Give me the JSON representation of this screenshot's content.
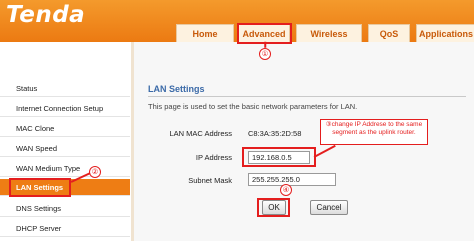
{
  "brand": {
    "logo": "Tenda"
  },
  "tabs": [
    {
      "label": "Home"
    },
    {
      "label": "Advanced"
    },
    {
      "label": "Wireless"
    },
    {
      "label": "QoS"
    },
    {
      "label": "Applications"
    }
  ],
  "sidebar": {
    "items": [
      {
        "label": "Status"
      },
      {
        "label": "Internet Connection Setup"
      },
      {
        "label": "MAC Clone"
      },
      {
        "label": "WAN Speed"
      },
      {
        "label": "WAN Medium Type"
      },
      {
        "label": "LAN Settings"
      },
      {
        "label": "DNS Settings"
      },
      {
        "label": "DHCP Server"
      }
    ]
  },
  "main": {
    "section_title": "LAN Settings",
    "description": "This page is used to set the basic network parameters for LAN.",
    "mac_label": "LAN MAC Address",
    "mac_value": "C8:3A:35:2D:58",
    "ip_label": "IP Address",
    "ip_value": "192.168.0.5",
    "subnet_label": "Subnet Mask",
    "subnet_value": "255.255.255.0",
    "ok_label": "OK",
    "cancel_label": "Cancel"
  },
  "annotations": {
    "step1": "①",
    "step2": "②",
    "step3_text": "③change IP Addrese to the same segment as the uplink router.",
    "step4": "④"
  },
  "colors": {
    "brand_orange": "#ec7a12",
    "active_menu": "#ee7d14",
    "annotation_red": "#e41e1e",
    "section_title": "#3b6aa8"
  }
}
